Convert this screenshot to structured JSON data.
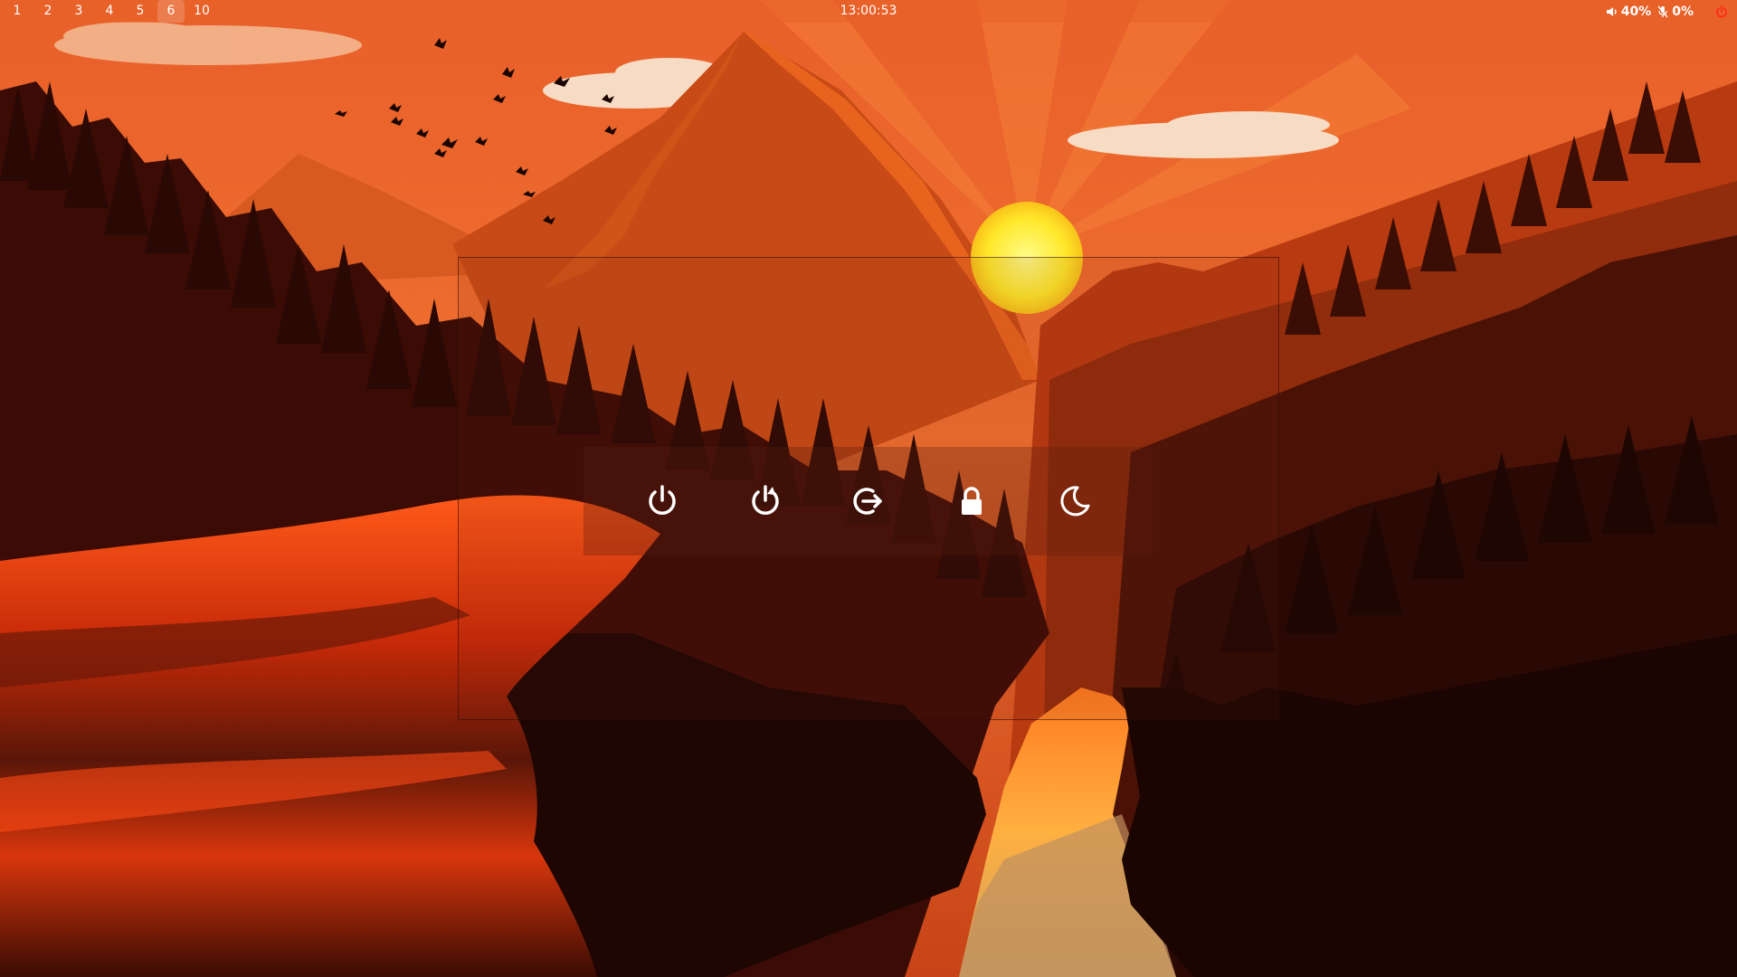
{
  "topbar": {
    "workspaces": [
      "1",
      "2",
      "3",
      "4",
      "5",
      "6",
      "10"
    ],
    "active_workspace": "6",
    "clock": "13:00:53",
    "volume": {
      "icon": "speaker-icon",
      "value": "40%"
    },
    "microphone": {
      "icon": "mic-muted-icon",
      "value": "0%"
    },
    "power": {
      "icon": "power-icon",
      "color": "#ff2a1a"
    }
  },
  "power_menu": {
    "buttons": [
      {
        "name": "shutdown-button",
        "icon": "power-icon"
      },
      {
        "name": "reboot-button",
        "icon": "reboot-icon"
      },
      {
        "name": "logout-button",
        "icon": "logout-icon"
      },
      {
        "name": "lock-button",
        "icon": "lock-icon"
      },
      {
        "name": "suspend-button",
        "icon": "moon-icon"
      }
    ]
  },
  "colors": {
    "sky": "#ee6b2a",
    "mountain": "#cf4a12",
    "sun": "#fff04a",
    "forest_dark": "#2a0905",
    "cliff": "#ff4a12",
    "river": "#ff9a2a"
  }
}
